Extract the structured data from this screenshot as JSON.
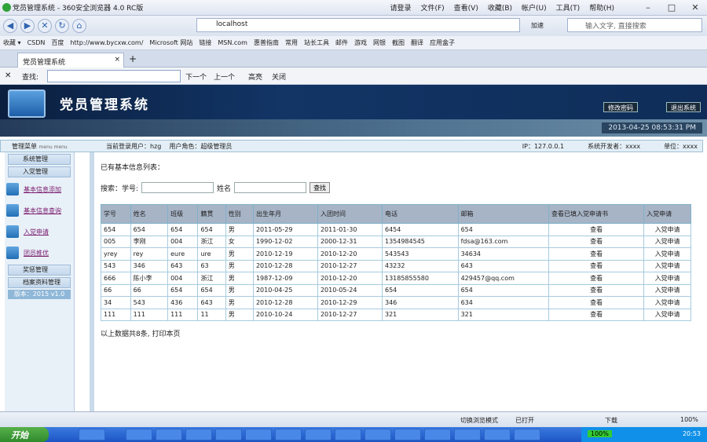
{
  "browser": {
    "title": "党员管理系统 - 360安全浏览器 4.0 RC版",
    "menu": [
      "请登录",
      "文件(F)",
      "查看(V)",
      "收藏(B)",
      "帐户(U)",
      "工具(T)",
      "帮助(H)"
    ],
    "address": "localhost",
    "search_placeholder": "输入文字, 直接搜索",
    "refresh_label": "加速"
  },
  "bookmarks": [
    "收藏 ▾",
    "CSDN",
    "百度",
    "http://www.bycxw.com/",
    "Microsoft 网站",
    "链接",
    "MSN.com",
    "惠普指南",
    "常用",
    "站长工具",
    "邮件",
    "游戏",
    "网银",
    "截图",
    "翻译",
    "应用盒子"
  ],
  "tab": {
    "label": "党员管理系统",
    "close": "×",
    "new": "+"
  },
  "findbar": {
    "label": "查找:",
    "next": "下一个",
    "prev": "上一个",
    "highlight": "高亮",
    "close": "关闭"
  },
  "header": {
    "title": "党员管理系统",
    "change_password": "修改密码",
    "logout": "退出系统",
    "datetime": "2013-04-25 08:53:31 PM"
  },
  "infobar": {
    "menu_title": "管理菜单",
    "menu_sub": "menu menu",
    "user": "当前登录用户：hzg",
    "role": "用户角色：超级管理员",
    "ip": "IP：127.0.0.1",
    "developer": "系统开发者：xxxx",
    "unit": "单位：xxxx"
  },
  "sidebar": {
    "items": [
      "系统管理",
      "入党管理"
    ],
    "links": [
      "基本信息添加",
      "基本信息查询",
      "入党申请",
      "团员推优"
    ],
    "items2": [
      "奖惩管理",
      "档案资料管理"
    ],
    "version": "版本：2015 v1.0"
  },
  "main": {
    "lead": "已有基本信息列表：",
    "search_label": "搜索：学号:",
    "name_label": "姓名",
    "search_button": "查找",
    "columns": [
      "学号",
      "姓名",
      "班级",
      "籍贯",
      "性别",
      "出生年月",
      "入团时间",
      "电话",
      "邮箱",
      "查看已填入党申请书",
      "入党申请"
    ],
    "rows": [
      [
        "654",
        "654",
        "654",
        "654",
        "男",
        "2011-05-29",
        "2011-01-30",
        "6454",
        "654",
        "查看",
        "入党申请"
      ],
      [
        "005",
        "李刚",
        "004",
        "浙江",
        "女",
        "1990-12-02",
        "2000-12-31",
        "1354984545",
        "fdsa@163.com",
        "查看",
        "入党申请"
      ],
      [
        "yrey",
        "rey",
        "eure",
        "ure",
        "男",
        "2010-12-19",
        "2010-12-20",
        "543543",
        "34634",
        "查看",
        "入党申请"
      ],
      [
        "543",
        "346",
        "643",
        "63",
        "男",
        "2010-12-28",
        "2010-12-27",
        "43232",
        "643",
        "查看",
        "入党申请"
      ],
      [
        "666",
        "陈小李",
        "004",
        "浙江",
        "男",
        "1987-12-09",
        "2010-12-20",
        "13185855580",
        "429457@qq.com",
        "查看",
        "入党申请"
      ],
      [
        "66",
        "66",
        "654",
        "654",
        "男",
        "2010-04-25",
        "2010-05-24",
        "654",
        "654",
        "查看",
        "入党申请"
      ],
      [
        "34",
        "543",
        "436",
        "643",
        "男",
        "2010-12-28",
        "2010-12-29",
        "346",
        "634",
        "查看",
        "入党申请"
      ],
      [
        "111",
        "111",
        "111",
        "11",
        "男",
        "2010-10-24",
        "2010-12-27",
        "321",
        "321",
        "查看",
        "入党申请"
      ]
    ],
    "footer": "以上数据共8条, 打印本页"
  },
  "statusbar": {
    "mode": "切换浏览模式",
    "opened": "已打开",
    "download": "下载",
    "zoom": "100%"
  },
  "taskbar": {
    "start": "开始",
    "battery": "100%",
    "clock": "20:53"
  }
}
